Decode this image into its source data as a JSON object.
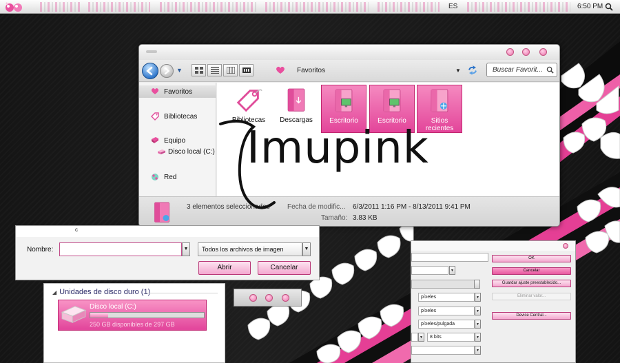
{
  "topbar": {
    "language": "ES",
    "clock": "6:50 PM"
  },
  "explorer": {
    "breadcrumb": "Favoritos",
    "search_placeholder": "Buscar Favorit...",
    "sidebar": {
      "favorites": "Favoritos",
      "libraries": "Bibliotecas",
      "computer": "Equipo",
      "local_disk": "Disco local (C:)",
      "network": "Red"
    },
    "items": [
      {
        "label": "Bibliotecas",
        "selected": false
      },
      {
        "label": "Descargas",
        "selected": false
      },
      {
        "label": "Escritorio",
        "selected": true
      },
      {
        "label": "Escritorio",
        "selected": true
      },
      {
        "label": "Sitios recientes",
        "selected": true
      }
    ],
    "details": {
      "count": "3 elementos seleccionados",
      "modified_label": "Fecha de modific...",
      "modified_value": "6/3/2011 1:16 PM - 8/13/2011 9:41 PM",
      "size_label": "Tamaño:",
      "size_value": "3.83 KB"
    }
  },
  "signature": "Imupink",
  "save_dialog": {
    "header_char": "c",
    "name_label": "Nombre:",
    "name_value": "",
    "file_type": "Todos los archivos de imagen",
    "open_button": "Abrir",
    "cancel_button": "Cancelar"
  },
  "drives": {
    "header": "Unidades de disco duro (1)",
    "drive_name": "Disco local (C:)",
    "free_text": "250 GB disponibles de 297 GB",
    "used_fraction": 0.16
  },
  "settings": {
    "unit1": "píxeles",
    "unit2": "píxeles",
    "unit3": "píxeles/pulgada",
    "depth": "8 bits",
    "ok": "OK",
    "cancel": "Cancelar",
    "save_preset": "Guardar ajuste preestablecido...",
    "delete_value": "Eliminar valor...",
    "device_central": "Device Central..."
  },
  "colors": {
    "accent_pink": "#e3459a",
    "light_pink": "#f3a8cf",
    "nav_blue": "#2b73c9"
  }
}
